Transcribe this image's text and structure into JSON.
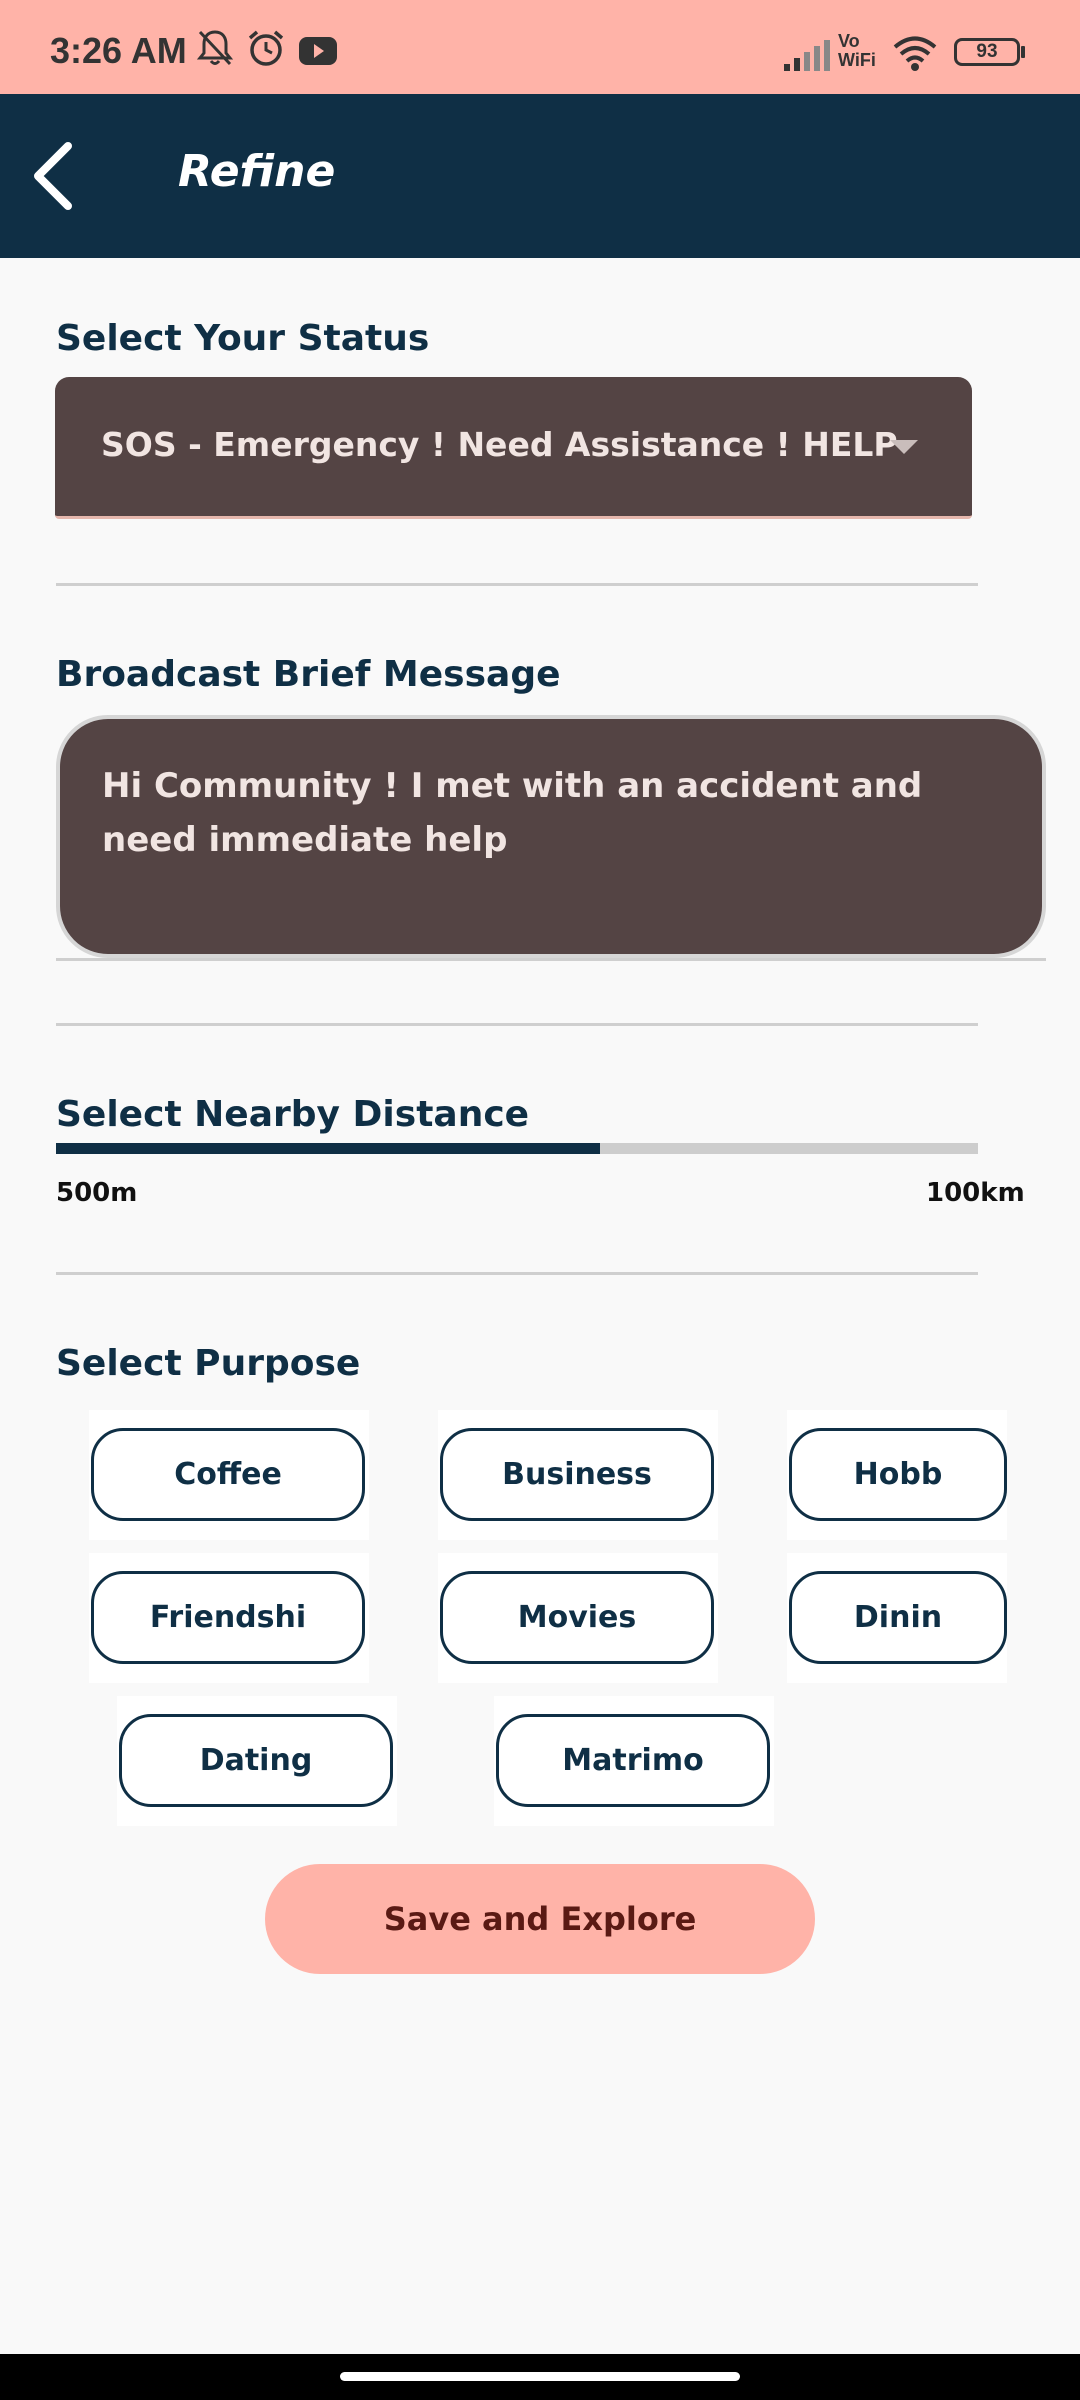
{
  "status_bar": {
    "time": "3:26 AM",
    "icons": [
      "notifications-off-icon",
      "alarm-icon",
      "youtube-icon",
      "signal-icon",
      "vowifi-icon",
      "wifi-icon"
    ],
    "vowifi_line1": "Vo",
    "vowifi_line2": "WiFi",
    "battery": "93"
  },
  "app_bar": {
    "title": "Refine",
    "back_icon": "chevron-left-icon"
  },
  "status_section": {
    "label": "Select Your Status",
    "selected": "SOS - Emergency ! Need Assistance ! HELP"
  },
  "message_section": {
    "label": "Broadcast Brief Message",
    "value": "Hi Community ! I met with an accident and need immediate help"
  },
  "distance_section": {
    "label": "Select Nearby Distance",
    "min_label": "500m",
    "max_label": "100km",
    "fill_fraction": 0.59
  },
  "purpose_section": {
    "label": "Select Purpose",
    "chips": [
      "Coffee",
      "Business",
      "Hobb",
      "Friendshi",
      "Movies",
      "Dinin",
      "Dating",
      "Matrimo"
    ]
  },
  "actions": {
    "save_label": "Save and Explore"
  },
  "colors": {
    "status_bar_bg": "#ffb3a8",
    "app_bar_bg": "#0f2f45",
    "field_bg": "#544444",
    "primary": "#0f2f45",
    "button_bg": "#ffb3a8"
  }
}
